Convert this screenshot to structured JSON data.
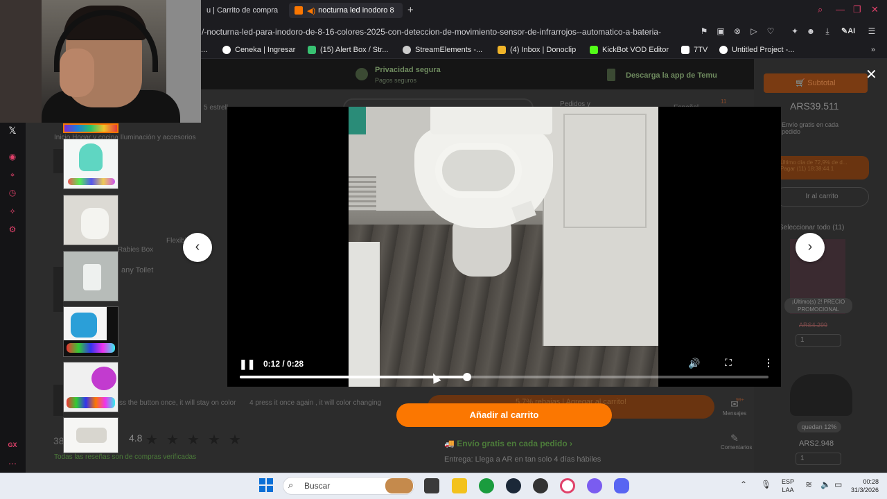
{
  "browser": {
    "tabs": [
      {
        "label": "u | Carrito de compra"
      },
      {
        "label": "nocturna led inodoro 8"
      }
    ],
    "new_tab": "+",
    "url": "/-nocturna-led-para-inodoro-de-8-16-colores-2025-con-deteccion-de-movimiento-sensor-de-infrarrojos--automatico-a-bateria-",
    "ai_label": "AI",
    "bookmarks": [
      {
        "label": "Ceneka | Ingresar",
        "color": "#ffffff"
      },
      {
        "label": "(15) Alert Box / Str...",
        "color": "#38c172"
      },
      {
        "label": "StreamElements -...",
        "color": "#cccccc"
      },
      {
        "label": "(4) Inbox | Donoclip",
        "color": "#f0b429"
      },
      {
        "label": "KickBot VOD Editor",
        "color": "#53fc18"
      },
      {
        "label": "7TV",
        "color": "#ffffff"
      },
      {
        "label": "Untitled Project -...",
        "color": "#ffffff"
      }
    ],
    "bookmark_prefix": "..."
  },
  "temu_header": {
    "privacy_title": "Privacidad segura",
    "privacy_sub": "Pagos seguros",
    "app_label": "Descarga la app de Temu",
    "stars_text": "5 estrell",
    "orders_label": "Pedidos y",
    "lang_label": "Español",
    "cart_count": "11"
  },
  "breadcrumb": "Inicio  Hogar y cocina  Iluminación y accesorios",
  "right_panel": {
    "subtotal_label": "Subtotal",
    "price": "ARS39.511",
    "free_ship": "Envío gratis en cada pedido",
    "promo": "Último día de 72,9% de d... Pagar (11) 18:38:44.1",
    "go_cart": "Ir al carrito",
    "select_all": "Seleccionar todo (11)",
    "product_tag": "¡Último(s) 2! PRECIO PROMOCIONAL",
    "old_price": "ARS4.299",
    "qty1": "1",
    "quedan": "quedan 12%",
    "price2": "ARS2.948",
    "qty2": "1"
  },
  "side_icons": {
    "messages_label": "Mensajes",
    "messages_badge": "99+",
    "comments_label": "Comentarios"
  },
  "page_lower": {
    "dim_cart_btn": "5.7% rebajas | Agregar al carrito!",
    "envio": "Envío gratis en cada pedido",
    "entrega": "Entrega: Llega a AR en tan solo 4 días hábiles",
    "rating_prefix": "38",
    "rating": "4.8",
    "verified": "Todas las reseñas son de compras verificadas",
    "caption_left": "ss the button once, it will stay on color",
    "caption_right": "4  press it once again , it will color changing",
    "dim_label1": "Rabies Box",
    "dim_label2": "Flexible LED",
    "dim_label3": "any Toilet"
  },
  "video": {
    "time": "0:12 / 0:28",
    "progress": 0.43
  },
  "modal": {
    "add_to_cart": "Añadir al carrito"
  },
  "taskbar": {
    "search_placeholder": "Buscar",
    "lang_top": "ESP",
    "lang_bottom": "LAA",
    "time": "00:28",
    "date": "31/3/2026"
  },
  "colors": {
    "temu_orange": "#fb7701",
    "opera_red": "#e0416a",
    "green": "#4c7c3a"
  }
}
